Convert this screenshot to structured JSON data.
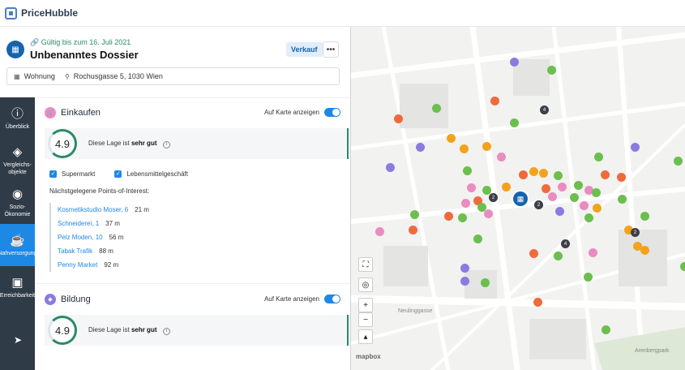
{
  "app": {
    "name": "PriceHubble"
  },
  "dossier": {
    "valid": "Gültig bis zum 16. Juli 2021",
    "title": "Unbenanntes Dossier",
    "badge": "Verkauf",
    "more": "•••",
    "property_type": "Wohnung",
    "address": "Rochusgasse 5, 1030 Wien"
  },
  "sidebar": {
    "items": [
      {
        "label": "Überblick",
        "icon": "info-icon"
      },
      {
        "label": "Vergleichs-objekte",
        "icon": "tag-icon"
      },
      {
        "label": "Sozio-Ökonomie",
        "icon": "globe-icon"
      },
      {
        "label": "Nahversorgung",
        "icon": "coffee-icon"
      },
      {
        "label": "Erreichbarkeit",
        "icon": "car-icon"
      }
    ]
  },
  "sections": [
    {
      "title": "Einkaufen",
      "toggle_label": "Auf Karte anzeigen",
      "score": "4.9",
      "score_text_prefix": "Diese Lage ist",
      "score_text_rating": "sehr gut",
      "filters": [
        "Supermarkt",
        "Lebensmittelgeschäft"
      ],
      "poi_heading": "Nächstgelegene Points-of-Interest:",
      "pois": [
        {
          "name": "Kosmetikstudio Moser, 6",
          "dist": "21 m"
        },
        {
          "name": "Schneiderei, 1",
          "dist": "37 m"
        },
        {
          "name": "Pelz Moden, 10",
          "dist": "56 m"
        },
        {
          "name": "Tabak Trafik",
          "dist": "88 m"
        },
        {
          "name": "Penny Market",
          "dist": "92 m"
        }
      ]
    },
    {
      "title": "Bildung",
      "toggle_label": "Auf Karte anzeigen",
      "score": "4.9",
      "score_text_prefix": "Diese Lage ist",
      "score_text_rating": "sehr gut"
    }
  ],
  "map": {
    "streets": [
      "Neulinggasse",
      "Arenbergpark"
    ],
    "controls": [
      "fullscreen-icon",
      "locate-icon",
      "+",
      "−",
      "compass-icon"
    ],
    "attribution": "mapbox",
    "cluster_labels": [
      "4",
      "2",
      "2",
      "4",
      "2"
    ],
    "colors": {
      "shopping": "#e98cc0",
      "education": "#8b7be0",
      "food": "#f2a31c",
      "restaurant": "#ef6a3c",
      "green": "#6cbf4e",
      "accent": "#1664ad"
    }
  }
}
